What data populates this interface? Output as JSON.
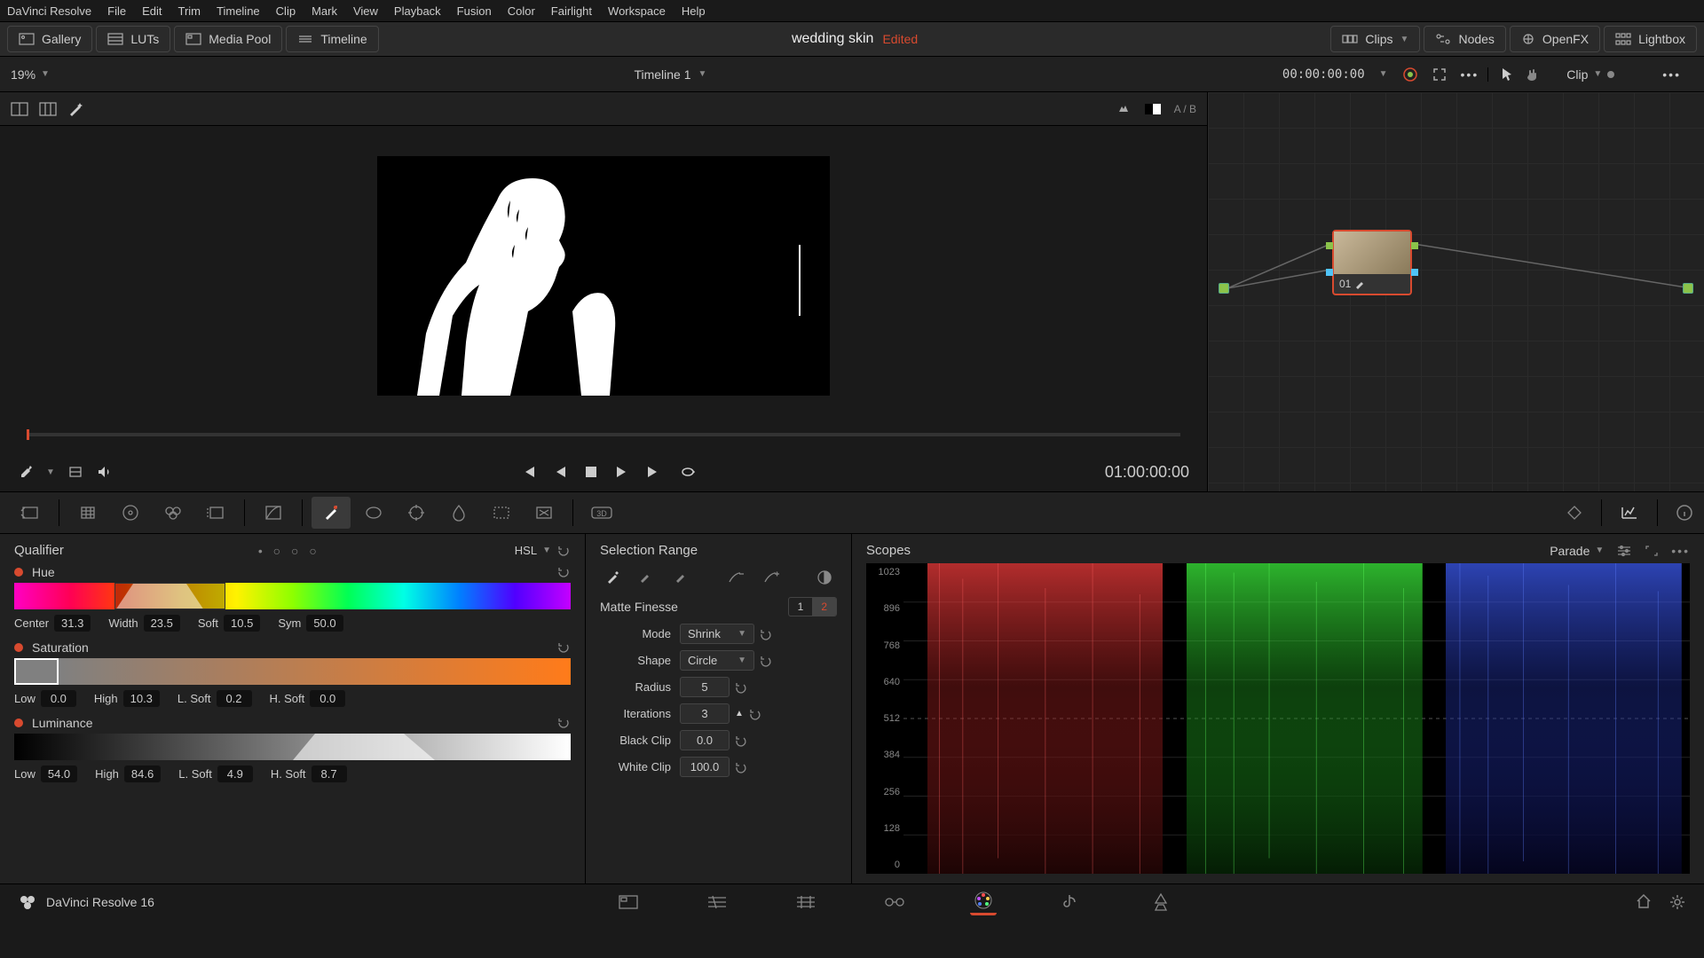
{
  "menu": [
    "DaVinci Resolve",
    "File",
    "Edit",
    "Trim",
    "Timeline",
    "Clip",
    "Mark",
    "View",
    "Playback",
    "Fusion",
    "Color",
    "Fairlight",
    "Workspace",
    "Help"
  ],
  "toolbar": {
    "gallery": "Gallery",
    "luts": "LUTs",
    "mediapool": "Media Pool",
    "timeline": "Timeline",
    "clips": "Clips",
    "nodes": "Nodes",
    "openfx": "OpenFX",
    "lightbox": "Lightbox"
  },
  "project": {
    "name": "wedding skin",
    "status": "Edited"
  },
  "secondbar": {
    "zoom": "19%",
    "timeline": "Timeline 1",
    "record_tc": "00:00:00:00",
    "clip_label": "Clip",
    "ab": "A / B"
  },
  "transport": {
    "tc": "01:00:00:00"
  },
  "node": {
    "label": "01"
  },
  "qualifier": {
    "title": "Qualifier",
    "mode": "HSL",
    "hue": {
      "label": "Hue",
      "center_lbl": "Center",
      "center": "31.3",
      "width_lbl": "Width",
      "width": "23.5",
      "soft_lbl": "Soft",
      "soft": "10.5",
      "sym_lbl": "Sym",
      "sym": "50.0"
    },
    "sat": {
      "label": "Saturation",
      "low_lbl": "Low",
      "low": "0.0",
      "high_lbl": "High",
      "high": "10.3",
      "lsoft_lbl": "L. Soft",
      "lsoft": "0.2",
      "hsoft_lbl": "H. Soft",
      "hsoft": "0.0"
    },
    "lum": {
      "label": "Luminance",
      "low_lbl": "Low",
      "low": "54.0",
      "high_lbl": "High",
      "high": "84.6",
      "lsoft_lbl": "L. Soft",
      "lsoft": "4.9",
      "hsoft_lbl": "H. Soft",
      "hsoft": "8.7"
    }
  },
  "selection": {
    "title": "Selection Range",
    "mf_title": "Matte Finesse",
    "tab1": "1",
    "tab2": "2",
    "mode_lbl": "Mode",
    "mode": "Shrink",
    "shape_lbl": "Shape",
    "shape": "Circle",
    "radius_lbl": "Radius",
    "radius": "5",
    "iter_lbl": "Iterations",
    "iter": "3",
    "black_lbl": "Black Clip",
    "black": "0.0",
    "white_lbl": "White Clip",
    "white": "100.0"
  },
  "scopes": {
    "title": "Scopes",
    "mode": "Parade",
    "ticks": [
      "1023",
      "896",
      "768",
      "640",
      "512",
      "384",
      "256",
      "128",
      "0"
    ]
  },
  "bottombar": {
    "app": "DaVinci Resolve 16"
  }
}
